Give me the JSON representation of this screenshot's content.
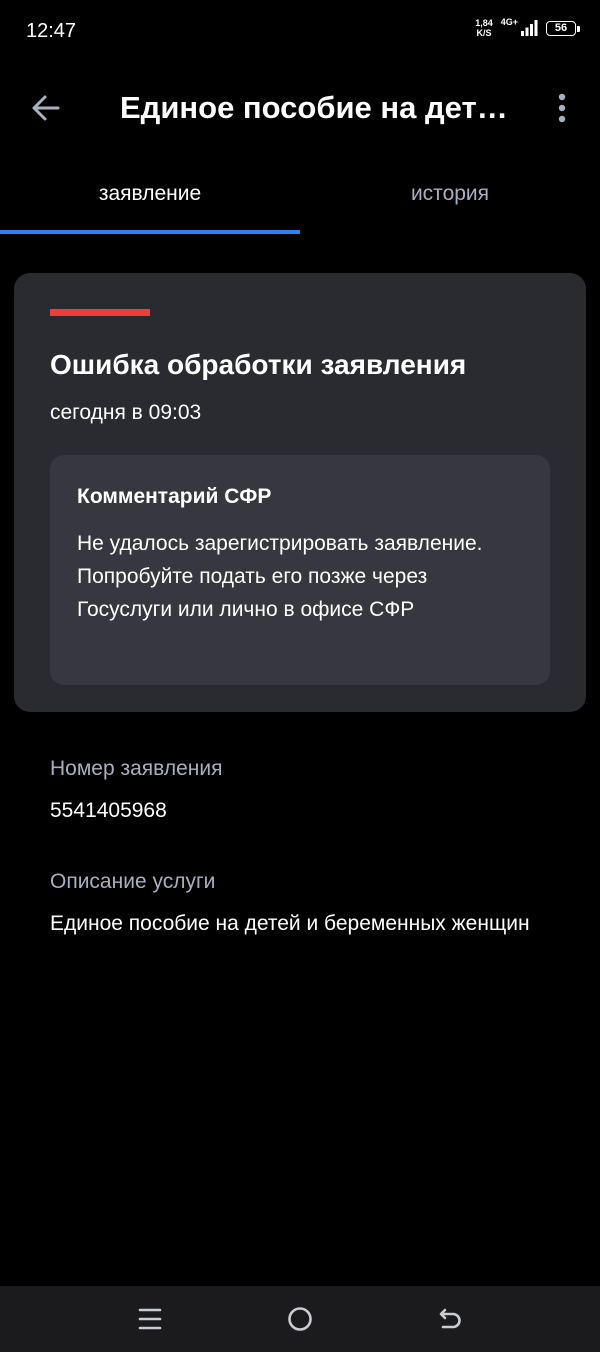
{
  "status_bar": {
    "time": "12:47",
    "net_speed_value": "1,84",
    "net_speed_unit": "K/S",
    "network_type": "4G+",
    "battery_level": "56"
  },
  "app_bar": {
    "title": "Единое пособие на детей и беременных женщин",
    "back_icon": "arrow-left-icon",
    "menu_icon": "more-vertical-icon"
  },
  "tabs": [
    {
      "label": "заявление",
      "active": true
    },
    {
      "label": "история",
      "active": false
    }
  ],
  "status_card": {
    "title": "Ошибка обработки заявления",
    "date": "сегодня в 09:03",
    "stripe_color": "#ef3d3a",
    "comment": {
      "title": "Комментарий СФР",
      "text": "Не удалось зарегистрировать заявление. Попробуйте подать его позже через Госуслуги или лично в офисе СФР"
    }
  },
  "details": {
    "application_number_label": "Номер заявления",
    "application_number": "5541405968",
    "service_description_label": "Описание услуги",
    "service_description": "Единое пособие на детей и беременных женщин"
  },
  "nav_bar": {
    "icons": [
      "menu-icon",
      "home-icon",
      "back-icon"
    ]
  },
  "colors": {
    "accent": "#2f7ff0",
    "error": "#ef3d3a",
    "card_background": "#2a2b31",
    "comment_background": "#37383f",
    "secondary_text": "#a7b0c0"
  }
}
